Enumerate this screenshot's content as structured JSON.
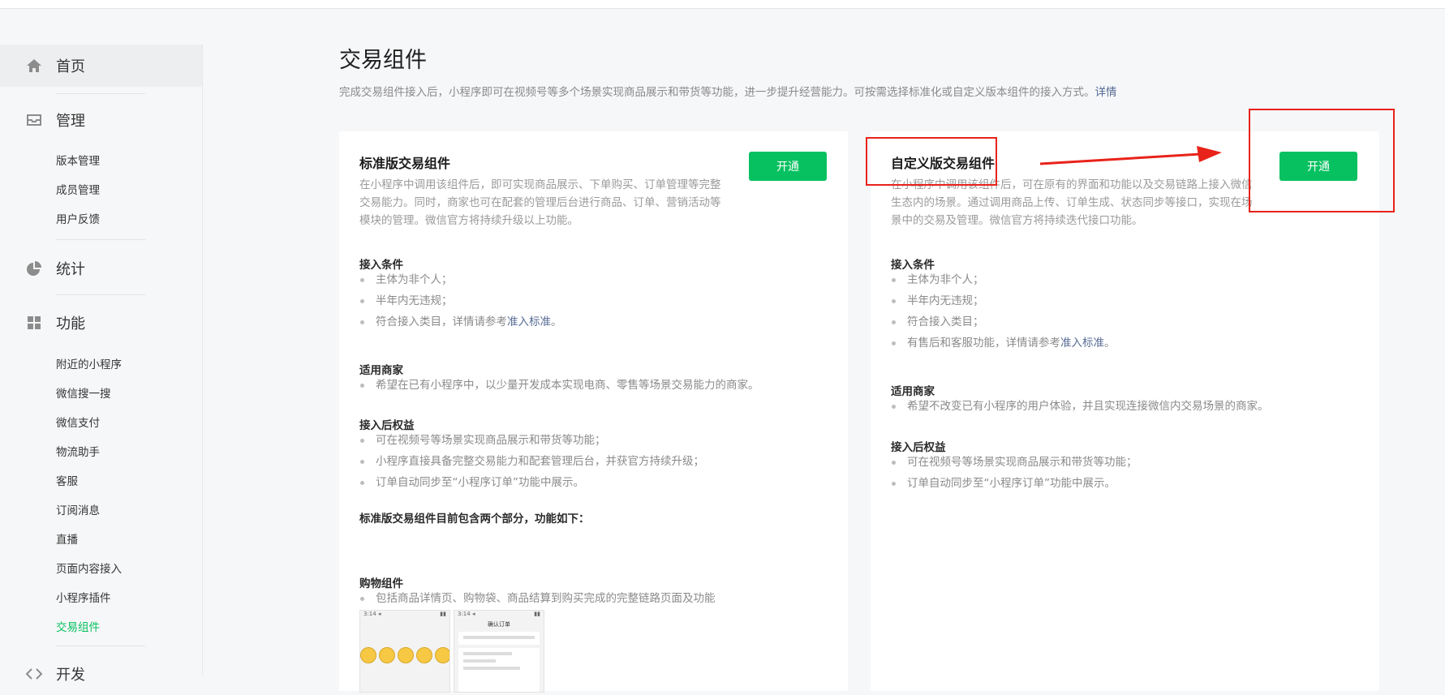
{
  "sidebar": {
    "groups": {
      "home": "首页",
      "manage": "管理",
      "stats": "统计",
      "features": "功能",
      "dev": "开发"
    },
    "manage_items": [
      "版本管理",
      "成员管理",
      "用户反馈"
    ],
    "feature_items": [
      "附近的小程序",
      "微信搜一搜",
      "微信支付",
      "物流助手",
      "客服",
      "订阅消息",
      "直播",
      "页面内容接入",
      "小程序插件",
      "交易组件"
    ]
  },
  "page": {
    "title": "交易组件",
    "description": "完成交易组件接入后，小程序即可在视频号等多个场景实现商品展示和带货等功能，进一步提升经营能力。可按需选择标准化或自定义版本组件的接入方式。",
    "details_link": "详情"
  },
  "standard": {
    "title": "标准版交易组件",
    "open_label": "开通",
    "description": "在小程序中调用该组件后，即可实现商品展示、下单购买、订单管理等完整交易能力。同时，商家也可在配套的管理后台进行商品、订单、营销活动等模块的管理。微信官方将持续升级以上功能。",
    "conditions_title": "接入条件",
    "conditions": [
      "主体为非个人；",
      "半年内无违规；"
    ],
    "condition_3_text": "符合接入类目，详情请参考",
    "condition_3_link": "准入标准",
    "condition_3_end": "。",
    "merchants_title": "适用商家",
    "merchants": [
      "希望在已有小程序中，以少量开发成本实现电商、零售等场景交易能力的商家。"
    ],
    "benefits_title": "接入后权益",
    "benefits": [
      "可在视频号等场景实现商品展示和带货等功能；",
      "小程序直接具备完整交易能力和配套管理后台，并获官方持续升级；",
      "订单自动同步至“小程序订单”功能中展示。"
    ],
    "parts_title": "标准版交易组件目前包含两个部分，功能如下：",
    "shopping_title": "购物组件",
    "shopping_items": [
      "包括商品详情页、购物袋、商品结算到购买完成的完整链路页面及功能"
    ],
    "thumb_time": "3:14 ◂",
    "thumb_order_title": "确认订单"
  },
  "custom": {
    "title": "自定义版交易组件",
    "open_label": "开通",
    "description": "在小程序中调用该组件后，可在原有的界面和功能以及交易链路上接入微信生态内的场景。通过调用商品上传、订单生成、状态同步等接口，实现在场景中的交易及管理。微信官方将持续迭代接口功能。",
    "conditions_title": "接入条件",
    "conditions": [
      "主体为非个人；",
      "半年内无违规；",
      "符合接入类目；"
    ],
    "condition_4_text": "有售后和客服功能，详情请参考",
    "condition_4_link": "准入标准",
    "condition_4_end": "。",
    "merchants_title": "适用商家",
    "merchants": [
      "希望不改变已有小程序的用户体验，并且实现连接微信内交易场景的商家。"
    ],
    "benefits_title": "接入后权益",
    "benefits": [
      "可在视频号等场景实现商品展示和带货等功能；",
      "订单自动同步至“小程序订单”功能中展示。"
    ]
  },
  "colors": {
    "accent_green": "#07c160",
    "link_blue": "#576b95",
    "annotation_red": "#e8231a"
  }
}
